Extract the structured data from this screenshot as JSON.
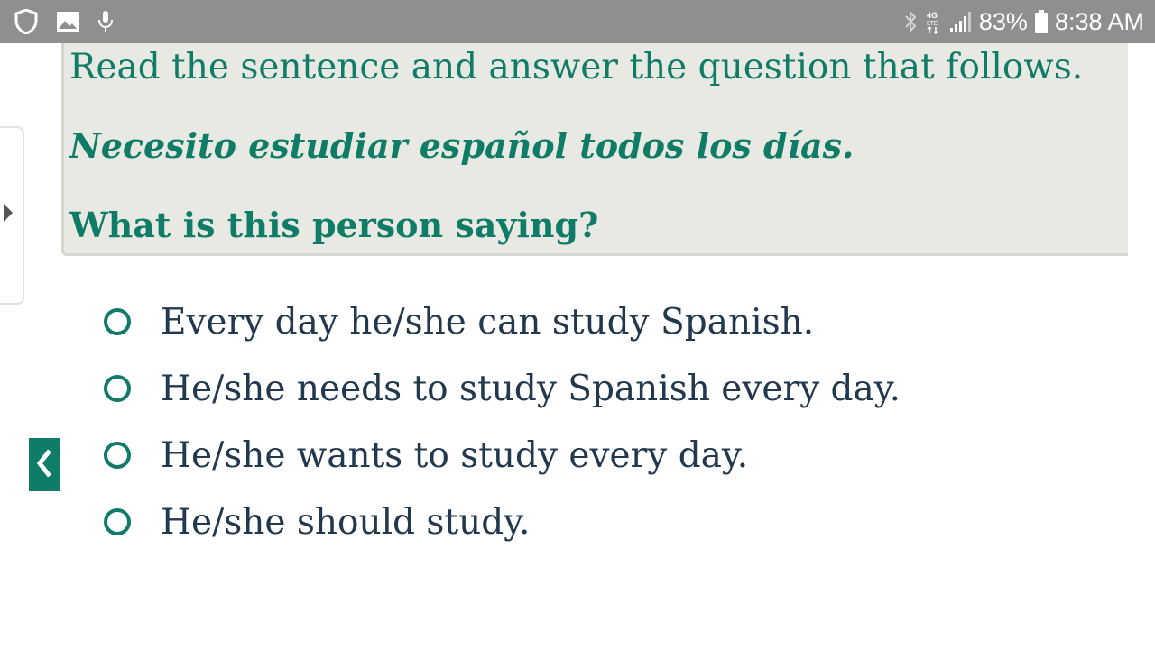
{
  "status_bar": {
    "left_icons": [
      "shield-icon",
      "image-icon",
      "microphone-icon"
    ],
    "right_icons": [
      "bluetooth-icon",
      "network-4g-lte-icon",
      "signal-icon",
      "battery-icon"
    ],
    "battery_percent": "83%",
    "time": "8:38 AM"
  },
  "side_tab": {
    "icon": "caret-right-icon"
  },
  "prompt": {
    "instruction": "Read the sentence and answer the question that follows.",
    "sentence": "Necesito estudiar español todos los días.",
    "question": "What is this person saying?"
  },
  "options": [
    {
      "label": "Every day he/she can study Spanish.",
      "selected": false
    },
    {
      "label": "He/she needs to study Spanish every day.",
      "selected": false
    },
    {
      "label": "He/she wants to study every day.",
      "selected": false
    },
    {
      "label": "He/she should study.",
      "selected": false
    }
  ],
  "back_button": {
    "icon": "chevron-left-icon"
  },
  "colors": {
    "accent": "#0e7c66",
    "status_bar": "#8f8f8f",
    "panel": "#e9e9e4",
    "option_text": "#22384e"
  }
}
